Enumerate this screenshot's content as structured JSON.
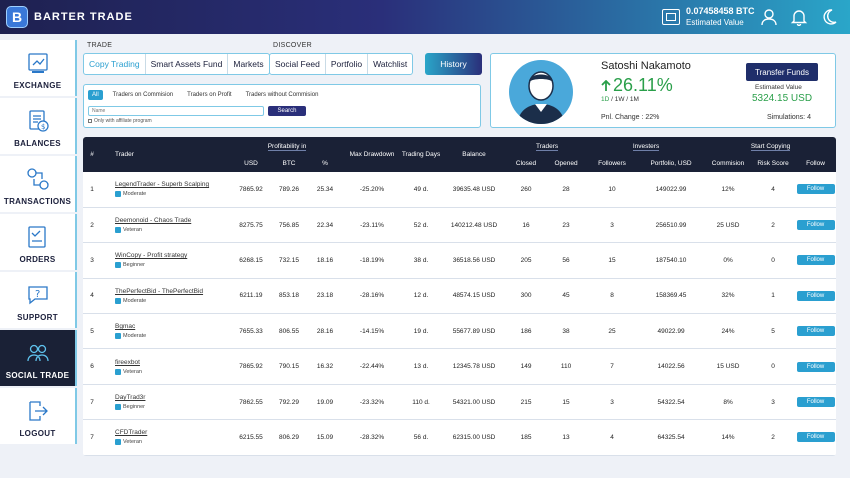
{
  "app": {
    "title": "BARTER TRADE",
    "logo_letter": "B"
  },
  "wallet": {
    "btc": "0.07458458 BTC",
    "label": "Estimated Value"
  },
  "sidebar": {
    "items": [
      {
        "label": "EXCHANGE",
        "icon": "exchange-icon"
      },
      {
        "label": "BALANCES",
        "icon": "balances-icon"
      },
      {
        "label": "TRANSACTIONS",
        "icon": "transactions-icon"
      },
      {
        "label": "ORDERS",
        "icon": "orders-icon"
      },
      {
        "label": "SUPPORT",
        "icon": "support-icon"
      },
      {
        "label": "SOCIAL TRADE",
        "icon": "social-trade-icon",
        "active": true
      },
      {
        "label": "LOGOUT",
        "icon": "logout-icon"
      }
    ]
  },
  "trade": {
    "label": "TRADE",
    "tabs": [
      "Copy Trading",
      "Smart Assets Fund",
      "Markets"
    ]
  },
  "discover": {
    "label": "DISCOVER",
    "tabs": [
      "Social Feed",
      "Portfolio",
      "Watchlist"
    ]
  },
  "history_label": "History",
  "filters": {
    "pills": [
      "All",
      "Traders on Commision",
      "Traders on Profit",
      "Traders without Commision"
    ],
    "search_placeholder": "Name",
    "search_label": "Search",
    "affiliate": "Only with affiliate program"
  },
  "profile": {
    "name": "Satoshi Nakamoto",
    "change": "26.11%",
    "period_current": "1D",
    "period_rest": " / 1W / 1M",
    "pnl": "Pnl. Change : 22%",
    "transfer_label": "Transfer Funds",
    "estimated_label": "Estimated Value",
    "estimated_value": "5324.15 USD",
    "simulations": "Simulations: 4"
  },
  "table": {
    "headers": {
      "num": "#",
      "trader": "Trader",
      "profitability": "Profitability in",
      "usd": "USD",
      "btc": "BTC",
      "pct": "%",
      "drawdown": "Max Drawdown",
      "days": "Trading Days",
      "balance": "Balance",
      "traders": "Traders",
      "closed": "Closed",
      "opened": "Opened",
      "investors": "Investers",
      "followers": "Followers",
      "portfolio": "Portfolio, USD",
      "start": "Start Copying",
      "commision": "Commision",
      "risk": "Risk Score",
      "follow": "Follow"
    },
    "follow_label": "Follow",
    "rows": [
      {
        "num": "1",
        "name": "LegendTrader - Superb Scalping",
        "level": "Moderate",
        "usd": "7865.92",
        "btc": "789.26",
        "pct": "25.34",
        "dd": "-25.20%",
        "days": "49 d.",
        "balance": "39635.48 USD",
        "closed": "260",
        "opened": "28",
        "followers": "10",
        "portfolio": "149022.99",
        "commision": "12%",
        "risk": "4"
      },
      {
        "num": "2",
        "name": "Deemonoid - Chaos Trade",
        "level": "Veteran",
        "usd": "8275.75",
        "btc": "756.85",
        "pct": "22.34",
        "dd": "-23.11%",
        "days": "52 d.",
        "balance": "140212.48 USD",
        "closed": "16",
        "opened": "23",
        "followers": "3",
        "portfolio": "256510.99",
        "commision": "25 USD",
        "risk": "2"
      },
      {
        "num": "3",
        "name": "WinCopy - Profit strategy",
        "level": "Beginner",
        "usd": "6268.15",
        "btc": "732.15",
        "pct": "18.16",
        "dd": "-18.19%",
        "days": "38 d.",
        "balance": "36518.56 USD",
        "closed": "205",
        "opened": "56",
        "followers": "15",
        "portfolio": "187540.10",
        "commision": "0%",
        "risk": "0"
      },
      {
        "num": "4",
        "name": "ThePerfectBid - ThePerfectBid",
        "level": "Moderate",
        "usd": "6211.19",
        "btc": "853.18",
        "pct": "23.18",
        "dd": "-28.16%",
        "days": "12 d.",
        "balance": "48574.15 USD",
        "closed": "300",
        "opened": "45",
        "followers": "8",
        "portfolio": "158369.45",
        "commision": "32%",
        "risk": "1"
      },
      {
        "num": "5",
        "name": "Bgmac",
        "level": "Moderate",
        "usd": "7655.33",
        "btc": "806.55",
        "pct": "28.16",
        "dd": "-14.15%",
        "days": "19 d.",
        "balance": "55677.89 USD",
        "closed": "186",
        "opened": "38",
        "followers": "25",
        "portfolio": "49022.99",
        "commision": "24%",
        "risk": "5"
      },
      {
        "num": "6",
        "name": "fireexbot",
        "level": "Veteran",
        "usd": "7865.92",
        "btc": "790.15",
        "pct": "16.32",
        "dd": "-22.44%",
        "days": "13 d.",
        "balance": "12345.78 USD",
        "closed": "149",
        "opened": "110",
        "followers": "7",
        "portfolio": "14022.56",
        "commision": "15 USD",
        "risk": "0"
      },
      {
        "num": "7",
        "name": "DayTrad3r",
        "level": "Beginner",
        "usd": "7862.55",
        "btc": "792.29",
        "pct": "19.09",
        "dd": "-23.32%",
        "days": "110 d.",
        "balance": "54321.00 USD",
        "closed": "215",
        "opened": "15",
        "followers": "3",
        "portfolio": "54322.54",
        "commision": "8%",
        "risk": "3"
      },
      {
        "num": "7",
        "name": "CFDTrader",
        "level": "Veteran",
        "usd": "6215.55",
        "btc": "806.29",
        "pct": "15.09",
        "dd": "-28.32%",
        "days": "56 d.",
        "balance": "62315.00 USD",
        "closed": "185",
        "opened": "13",
        "followers": "4",
        "portfolio": "64325.54",
        "commision": "14%",
        "risk": "2"
      }
    ]
  },
  "colors": {
    "accent": "#2a9fd0",
    "dark": "#1a2136",
    "positive": "#2a9f4a"
  }
}
